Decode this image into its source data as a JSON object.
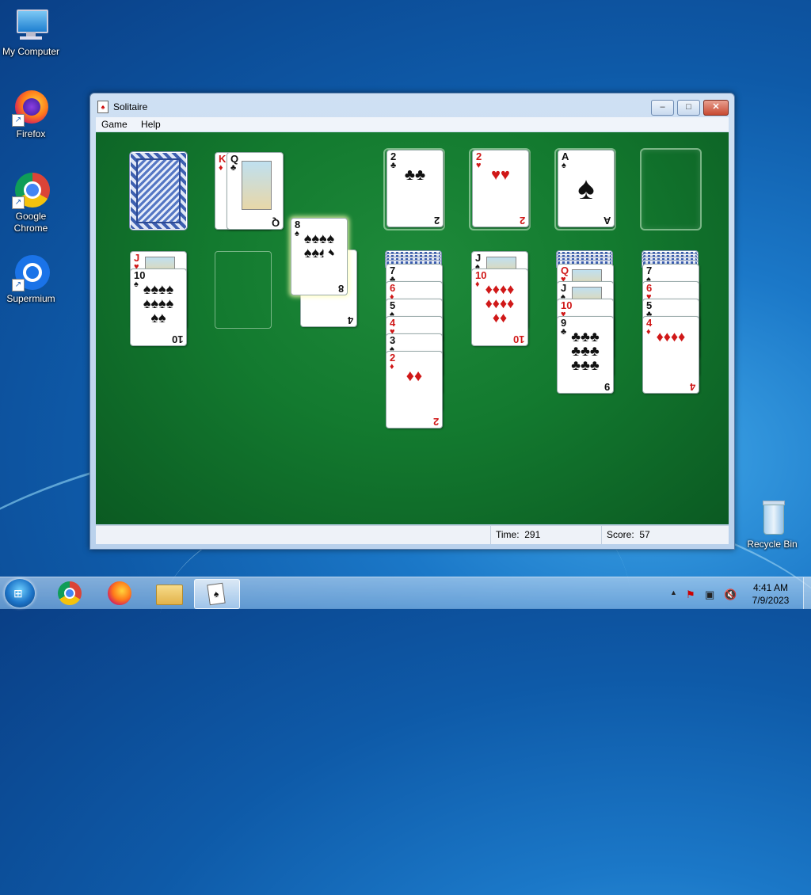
{
  "desktop": {
    "icons": [
      {
        "label": "My Computer"
      },
      {
        "label": "Firefox"
      },
      {
        "label": "Google Chrome"
      },
      {
        "label": "Supermium"
      },
      {
        "label": "Recycle Bin"
      }
    ]
  },
  "window": {
    "title": "Solitaire",
    "buttons": {
      "minimize": "–",
      "maximize": "□",
      "close": "✕"
    },
    "menu": [
      "Game",
      "Help"
    ],
    "status": {
      "time_label": "Time:",
      "time_value": "291",
      "score_label": "Score:",
      "score_value": "57"
    }
  },
  "game": {
    "waste": [
      {
        "rank": "K",
        "suit": "♦",
        "color": "red"
      },
      {
        "rank": "Q",
        "suit": "♣",
        "color": "black"
      }
    ],
    "dragging": [
      {
        "rank": "8",
        "suit": "♠",
        "color": "black"
      },
      {
        "rank": "4",
        "suit": "♠",
        "color": "black"
      }
    ],
    "foundations": [
      {
        "rank": "2",
        "suit": "♣",
        "color": "black"
      },
      {
        "rank": "2",
        "suit": "♥",
        "color": "red"
      },
      {
        "rank": "A",
        "suit": "♠",
        "color": "black"
      },
      {
        "rank": "",
        "suit": "",
        "color": ""
      }
    ],
    "tableau": [
      {
        "face_down": 0,
        "cards": [
          {
            "rank": "J",
            "suit": "♥",
            "color": "red"
          },
          {
            "rank": "10",
            "suit": "♠",
            "color": "black"
          }
        ]
      },
      {
        "face_down": 0,
        "cards": []
      },
      {
        "face_down": 0,
        "cards": []
      },
      {
        "face_down": 4,
        "cards": [
          {
            "rank": "7",
            "suit": "♣",
            "color": "black"
          },
          {
            "rank": "6",
            "suit": "♦",
            "color": "red"
          },
          {
            "rank": "5",
            "suit": "♠",
            "color": "black"
          },
          {
            "rank": "4",
            "suit": "♥",
            "color": "red"
          },
          {
            "rank": "3",
            "suit": "♠",
            "color": "black"
          },
          {
            "rank": "2",
            "suit": "♦",
            "color": "red"
          }
        ]
      },
      {
        "face_down": 0,
        "cards": [
          {
            "rank": "J",
            "suit": "♠",
            "color": "black"
          },
          {
            "rank": "10",
            "suit": "♦",
            "color": "red"
          }
        ]
      },
      {
        "face_down": 4,
        "cards": [
          {
            "rank": "Q",
            "suit": "♥",
            "color": "red"
          },
          {
            "rank": "J",
            "suit": "♠",
            "color": "black"
          },
          {
            "rank": "10",
            "suit": "♥",
            "color": "red"
          },
          {
            "rank": "9",
            "suit": "♣",
            "color": "black"
          }
        ]
      },
      {
        "face_down": 4,
        "cards": [
          {
            "rank": "7",
            "suit": "♠",
            "color": "black"
          },
          {
            "rank": "6",
            "suit": "♥",
            "color": "red"
          },
          {
            "rank": "5",
            "suit": "♣",
            "color": "black"
          },
          {
            "rank": "4",
            "suit": "♦",
            "color": "red"
          }
        ]
      }
    ]
  },
  "taskbar": {
    "pinned": [
      "chrome-icon",
      "firefox-icon",
      "explorer-icon",
      "solitaire-icon"
    ],
    "clock_time": "4:41 AM",
    "clock_date": "7/9/2023"
  }
}
